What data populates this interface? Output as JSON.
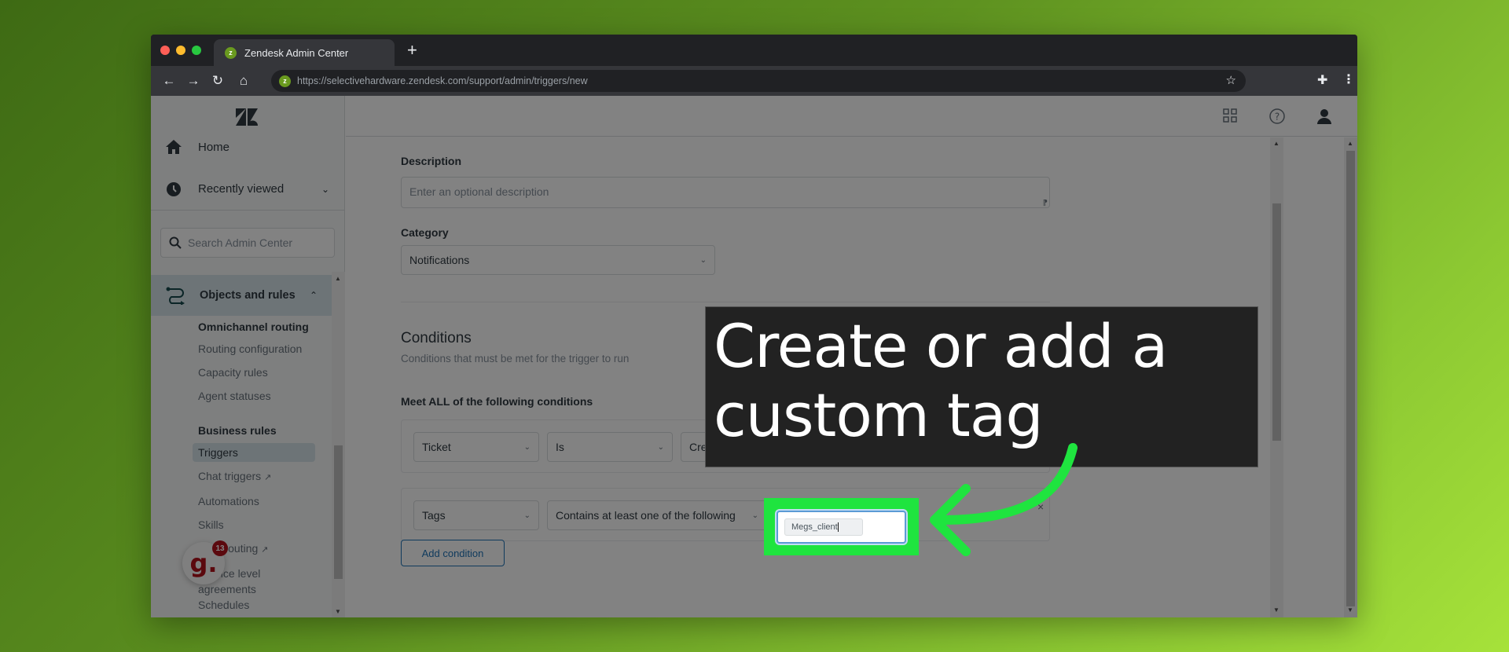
{
  "browser": {
    "tab_title": "Zendesk Admin Center",
    "favicon_letter": "z",
    "new_tab": "+",
    "url": "https://selectivehardware.zendesk.com/support/admin/triggers/new",
    "nav": {
      "back": "←",
      "forward": "→",
      "reload": "↻",
      "home": "⌂"
    },
    "star": "☆",
    "extensions": "✚",
    "menu": "⋮"
  },
  "sidebar": {
    "home": "Home",
    "recently_viewed": "Recently viewed",
    "search_placeholder": "Search Admin Center",
    "section": "Objects and rules",
    "groups": [
      {
        "heading": "Omnichannel routing",
        "items": [
          "Routing configuration",
          "Capacity rules",
          "Agent statuses"
        ]
      },
      {
        "heading": "Business rules",
        "items": [
          "Triggers",
          "Chat triggers",
          "Automations",
          "Skills",
          "Chat routing",
          "Service level agreements",
          "Schedules"
        ]
      }
    ],
    "active_item": "Triggers",
    "grammarly_badge": "13",
    "grammarly_letter": "g."
  },
  "header": {
    "icons": [
      "products-grid-icon",
      "help-icon",
      "user-profile-icon"
    ]
  },
  "form": {
    "description_label": "Description",
    "description_placeholder": "Enter an optional description",
    "category_label": "Category",
    "category_value": "Notifications",
    "conditions_title": "Conditions",
    "conditions_subtitle": "Conditions that must be met for the trigger to run",
    "meet_all_label": "Meet ALL of the following conditions",
    "condition_rows": [
      {
        "field": "Ticket",
        "operator": "Is",
        "value": "Created"
      },
      {
        "field": "Tags",
        "operator": "Contains at least one of the following",
        "value": "Megs_client"
      }
    ],
    "remove_condition": "×",
    "add_condition": "Add condition"
  },
  "annotation": {
    "callout_line1": "Create or add a",
    "callout_line2": "custom tag",
    "highlight_color": "#1fe43f"
  }
}
